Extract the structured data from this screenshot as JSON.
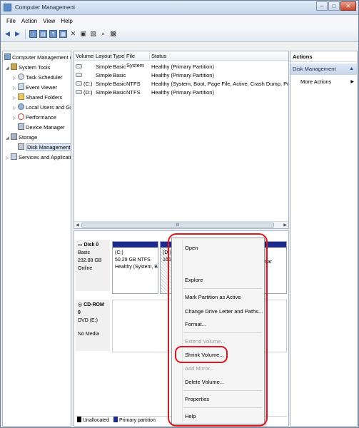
{
  "window": {
    "title": "Computer Management"
  },
  "menubar": {
    "items": [
      "File",
      "Action",
      "View",
      "Help"
    ]
  },
  "toolbar": {
    "icons": [
      "back-icon",
      "forward-icon",
      "up-icon",
      "show-tree-icon",
      "help-icon",
      "properties-icon",
      "delete-icon",
      "export-icon",
      "new-icon",
      "search-icon",
      "refresh-icon"
    ]
  },
  "tree": {
    "items": [
      {
        "label": "Computer Management (Local",
        "icon": "computer-icon"
      },
      {
        "label": "System Tools",
        "icon": "tools-icon"
      },
      {
        "label": "Task Scheduler",
        "icon": "clock-icon"
      },
      {
        "label": "Event Viewer",
        "icon": "event-icon"
      },
      {
        "label": "Shared Folders",
        "icon": "folder-icon"
      },
      {
        "label": "Local Users and Groups",
        "icon": "users-icon"
      },
      {
        "label": "Performance",
        "icon": "performance-icon"
      },
      {
        "label": "Device Manager",
        "icon": "device-icon"
      },
      {
        "label": "Storage",
        "icon": "storage-icon"
      },
      {
        "label": "Disk Management",
        "icon": "disk-icon"
      },
      {
        "label": "Services and Applications",
        "icon": "services-icon"
      }
    ]
  },
  "volume_list": {
    "columns": [
      "Volume",
      "Layout",
      "Type",
      "File System",
      "Status"
    ],
    "rows": [
      {
        "volume": "",
        "layout": "Simple",
        "type": "Basic",
        "fs": "",
        "status": "Healthy (Primary Partition)"
      },
      {
        "volume": "",
        "layout": "Simple",
        "type": "Basic",
        "fs": "",
        "status": "Healthy (Primary Partition)"
      },
      {
        "volume": "(C:)",
        "layout": "Simple",
        "type": "Basic",
        "fs": "NTFS",
        "status": "Healthy (System, Boot, Page File, Active, Crash Dump, Primary Partition"
      },
      {
        "volume": "(D:)",
        "layout": "Simple",
        "type": "Basic",
        "fs": "NTFS",
        "status": "Healthy (Primary Partition)"
      }
    ],
    "scroll_grip": "III"
  },
  "disks": {
    "disk0": {
      "name": "Disk 0",
      "type": "Basic",
      "size": "232.88 GB",
      "state": "Online"
    },
    "cdrom0": {
      "name": "CD-ROM 0",
      "type": "DVD (E:)",
      "state": "No Media"
    },
    "partitions": {
      "c": {
        "name": "(C:)",
        "size": "50.29 GB NTFS",
        "status": "Healthy (System, Boo"
      },
      "d": {
        "name": "(D:)",
        "size": "166.0"
      },
      "last": {
        "status": "(Primar"
      }
    }
  },
  "legend": {
    "unallocated": "Unallocated",
    "primary": "Primary partition"
  },
  "actions": {
    "header": "Actions",
    "section": "Disk Management",
    "more": "More Actions"
  },
  "context_menu": {
    "open": "Open",
    "explore": "Explore",
    "mark_active": "Mark Partition as Active",
    "change_letter": "Change Drive Letter and Paths...",
    "format": "Format...",
    "extend": "Extend Volume...",
    "shrink": "Shrink Volume...",
    "add_mirror": "Add Mirror...",
    "delete": "Delete Volume...",
    "properties": "Properties",
    "help": "Help"
  },
  "colors": {
    "primary_partition": "#1d2a8e",
    "unallocated": "#000000",
    "annotation": "#e0161c"
  }
}
